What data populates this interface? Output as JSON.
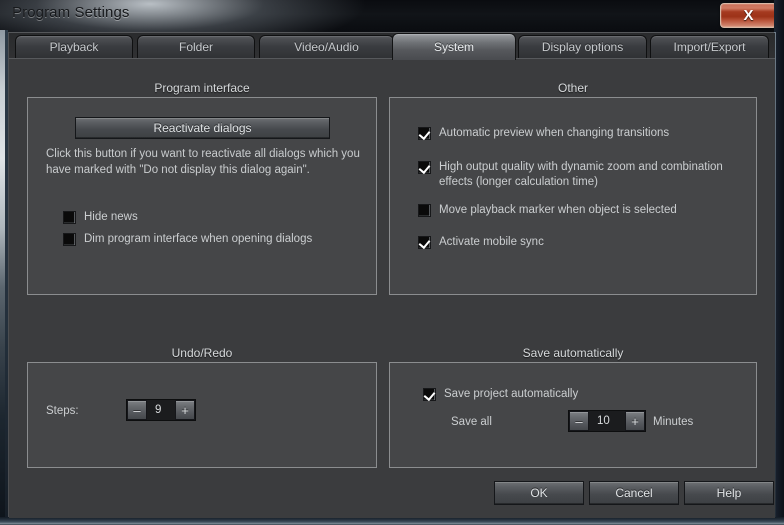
{
  "window": {
    "title": "Program Settings",
    "close_icon": "close-x-icon",
    "close_label": "X",
    "accent_close": "#a53a20",
    "panel_bg": "#454648",
    "dialog_bg": "#3b3c3e"
  },
  "tabs": [
    {
      "label": "Playback",
      "active": false
    },
    {
      "label": "Folder",
      "active": false
    },
    {
      "label": "Video/Audio",
      "active": false
    },
    {
      "label": "System",
      "active": true
    },
    {
      "label": "Display options",
      "active": false
    },
    {
      "label": "Import/Export",
      "active": false
    }
  ],
  "groups": {
    "program_interface": {
      "title": "Program interface",
      "button_label": "Reactivate dialogs",
      "help_text": "Click this button if you want to reactivate all dialogs which you have marked with \"Do not display this dialog again\".",
      "checkboxes": [
        {
          "label": "Hide news",
          "checked": false
        },
        {
          "label": "Dim program interface when opening dialogs",
          "checked": false
        }
      ]
    },
    "other": {
      "title": "Other",
      "checkboxes": [
        {
          "label": "Automatic preview when changing transitions",
          "checked": true
        },
        {
          "label": "High output quality with dynamic zoom and combination effects (longer calculation time)",
          "checked": true
        },
        {
          "label": "Move playback marker when object is selected",
          "checked": false
        },
        {
          "label": "Activate mobile sync",
          "checked": true
        }
      ]
    },
    "undo_redo": {
      "title": "Undo/Redo",
      "steps_label": "Steps:",
      "steps_value": "9",
      "minus_label": "–",
      "plus_label": "+"
    },
    "save_automatically": {
      "title": "Save automatically",
      "checkbox": {
        "label": "Save project automatically",
        "checked": true
      },
      "save_all_label": "Save all",
      "interval_value": "10",
      "unit_label": "Minutes",
      "minus_label": "–",
      "plus_label": "+"
    }
  },
  "footer": {
    "ok_label": "OK",
    "cancel_label": "Cancel",
    "help_label": "Help"
  }
}
